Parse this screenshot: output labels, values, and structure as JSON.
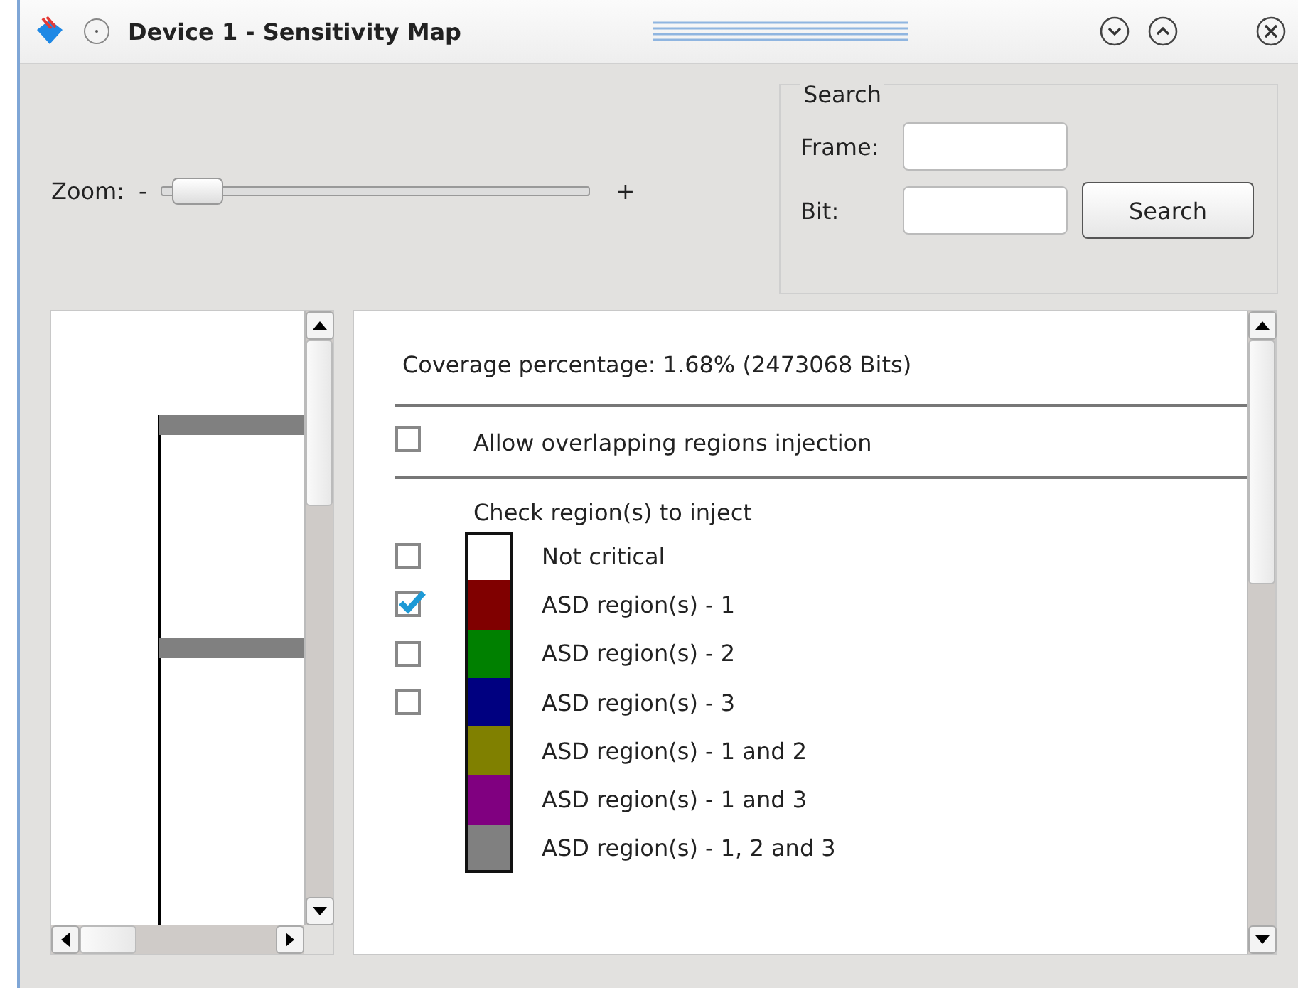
{
  "window": {
    "title": "Device 1 - Sensitivity Map"
  },
  "zoom": {
    "label": "Zoom:",
    "minus": "-",
    "plus": "+",
    "level": 0.03
  },
  "search": {
    "title": "Search",
    "frame_label": "Frame:",
    "bit_label": "Bit:",
    "button": "Search"
  },
  "coverage": "Coverage percentage: 1.68% (2473068 Bits)",
  "allow_overlap": {
    "label": "Allow overlapping regions injection",
    "checked": false
  },
  "regions_heading": "Check region(s) to inject",
  "regions": [
    {
      "label": "Not critical",
      "kind": "checkbox",
      "checked": false,
      "color": "#ffffff"
    },
    {
      "label": "ASD region(s) - 1",
      "kind": "checkbox",
      "checked": true,
      "color": "#800000"
    },
    {
      "label": "ASD region(s) - 2",
      "kind": "checkbox",
      "checked": false,
      "color": "#008000"
    },
    {
      "label": "ASD region(s) - 3",
      "kind": "checkbox",
      "checked": false,
      "color": "#000080"
    },
    {
      "label": "ASD region(s) - 1 and 2",
      "kind": "swatch",
      "color": "#808000"
    },
    {
      "label": "ASD region(s) - 1 and 3",
      "kind": "swatch",
      "color": "#800080"
    },
    {
      "label": "ASD region(s) - 1, 2 and 3",
      "kind": "swatch",
      "color": "#808080"
    }
  ]
}
